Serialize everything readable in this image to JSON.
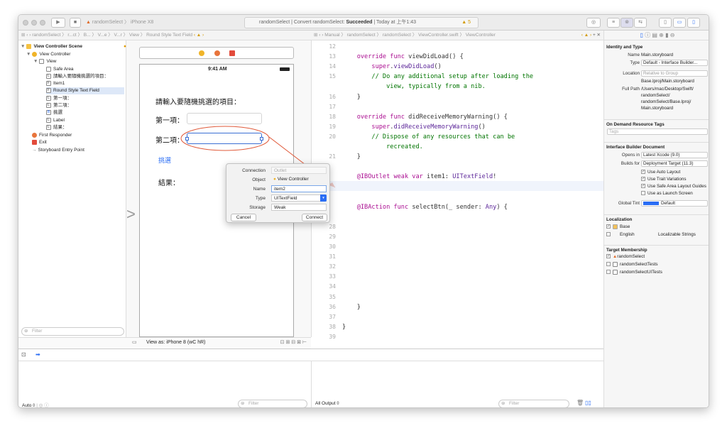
{
  "toolbar": {
    "scheme_target": "randomSelect",
    "scheme_device": "iPhone X8",
    "status_project": "randomSelect",
    "status_action": "Convert randomSelect:",
    "status_result": "Succeeded",
    "status_time": "Today at 上午1:43",
    "warning_count": "5"
  },
  "jumpbar_left": "randomSelect 〉 r...ct 〉 B... 〉 V...e 〉 V...r 〉 View 〉 Round Style Text Field",
  "jumpbar_right": "Manual 〉 randomSelect 〉 randomSelect 〉 ViewController.swift 〉 ViewController",
  "outline": {
    "scene": "View Controller Scene",
    "controller": "View Controller",
    "view": "View",
    "items": [
      "Safe Area",
      "請輸入要隨機挑選的項目：",
      "Item1",
      "Round Style Text Field",
      "第一項：",
      "第二項：",
      "挑選",
      "Label",
      "結果："
    ],
    "first_responder": "First Responder",
    "exit": "Exit",
    "entry": "Storyboard Entry Point",
    "filter_placeholder": "Filter"
  },
  "canvas": {
    "time": "9:41 AM",
    "prompt": "請輸入要隨機挑選的項目：",
    "item1_label": "第一項：",
    "item2_label": "第二項：",
    "pick_button": "挑選",
    "result_label": "結果：",
    "view_as": "View as: iPhone 8 (wC hR)"
  },
  "popup": {
    "connection_label": "Connection",
    "connection_value": "Outlet",
    "object_label": "Object",
    "object_value": "View Controller",
    "name_label": "Name",
    "name_value": "item2",
    "type_label": "Type",
    "type_value": "UITextField",
    "storage_label": "Storage",
    "storage_value": "Weak",
    "cancel": "Cancel",
    "connect": "Connect"
  },
  "code_lines": [
    {
      "n": "12",
      "html": ""
    },
    {
      "n": "13",
      "html": "    <span class='kw'>override func</span> viewDidLoad() {"
    },
    {
      "n": "14",
      "html": "        <span class='kw'>super</span>.<span class='ty'>viewDidLoad</span>()"
    },
    {
      "n": "15",
      "html": "        <span class='cm'>// Do any additional setup after loading the</span>"
    },
    {
      "n": "",
      "html": "            <span class='cm'>view, typically from a nib.</span>"
    },
    {
      "n": "16",
      "html": "    }"
    },
    {
      "n": "17",
      "html": ""
    },
    {
      "n": "18",
      "html": "    <span class='kw'>override func</span> didReceiveMemoryWarning() {"
    },
    {
      "n": "19",
      "html": "        <span class='kw'>super</span>.<span class='ty'>didReceiveMemoryWarning</span>()"
    },
    {
      "n": "20",
      "html": "        <span class='cm'>// Dispose of any resources that can be</span>"
    },
    {
      "n": "",
      "html": "            <span class='cm'>recreated.</span>"
    },
    {
      "n": "21",
      "html": "    }"
    },
    {
      "n": "",
      "html": ""
    },
    {
      "n": "",
      "html": "    <span class='kw'>@IBOutlet weak var</span> item1: <span class='ty'>UITextField</span>!"
    },
    {
      "n": "",
      "html": ""
    },
    {
      "n": "",
      "html": ""
    },
    {
      "n": "",
      "html": "    <span class='kw'>@IBAction func</span> selectBtn(_ sender: <span class='ty'>Any</span>) {"
    },
    {
      "n": "",
      "html": ""
    },
    {
      "n": "28",
      "html": ""
    },
    {
      "n": "29",
      "html": ""
    },
    {
      "n": "30",
      "html": ""
    },
    {
      "n": "31",
      "html": ""
    },
    {
      "n": "32",
      "html": ""
    },
    {
      "n": "33",
      "html": ""
    },
    {
      "n": "34",
      "html": ""
    },
    {
      "n": "35",
      "html": ""
    },
    {
      "n": "36",
      "html": "    }"
    },
    {
      "n": "37",
      "html": ""
    },
    {
      "n": "38",
      "html": "}"
    },
    {
      "n": "39",
      "html": ""
    }
  ],
  "inspector": {
    "identity_title": "Identity and Type",
    "name_label": "Name",
    "name_value": "Main.storyboard",
    "type_label": "Type",
    "type_value": "Default - Interface Builder...",
    "location_label": "Location",
    "location_value": "Relative to Group",
    "location_file": "Base.lproj/Main.storyboard",
    "fullpath_label": "Full Path",
    "fullpath_value": "/Users/mac/Desktop/Swift/ randomSelect/ randomSelect/Base.lproj/ Main.storyboard",
    "ondemand_title": "On Demand Resource Tags",
    "tags_placeholder": "Tags",
    "ibdoc_title": "Interface Builder Document",
    "opensin_label": "Opens in",
    "opensin_value": "Latest Xcode (9.0)",
    "buildsfor_label": "Builds for",
    "buildsfor_value": "Deployment Target (11.3)",
    "opt_autolayout": "Use Auto Layout",
    "opt_trait": "Use Trait Variations",
    "opt_safearea": "Use Safe Area Layout Guides",
    "opt_launch": "Use as Launch Screen",
    "globaltint_label": "Global Tint",
    "globaltint_value": "Default",
    "localization_title": "Localization",
    "loc_base": "Base",
    "loc_english": "English",
    "loc_english_value": "Localizable Strings",
    "target_title": "Target Membership",
    "target1": "randomSelect",
    "target2": "randomSelectTests",
    "target3": "randomSelectUITests"
  },
  "bottom": {
    "auto_label": "Auto ◊",
    "filter1": "Filter",
    "all_output": "All Output ◊",
    "filter2": "Filter"
  }
}
